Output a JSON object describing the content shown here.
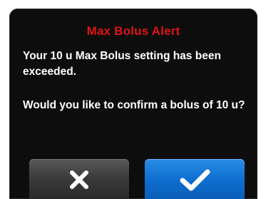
{
  "alert": {
    "title": "Max Bolus Alert",
    "message": "Your 10 u Max Bolus setting has been exceeded.",
    "question": "Would you like to confirm a bolus of 10 u?"
  },
  "buttons": {
    "cancel_icon": "x-icon",
    "confirm_icon": "check-icon"
  },
  "colors": {
    "title": "#e01414",
    "background": "#0d0d0d",
    "confirm": "#0f6fd1",
    "cancel": "#3c3c3c"
  }
}
